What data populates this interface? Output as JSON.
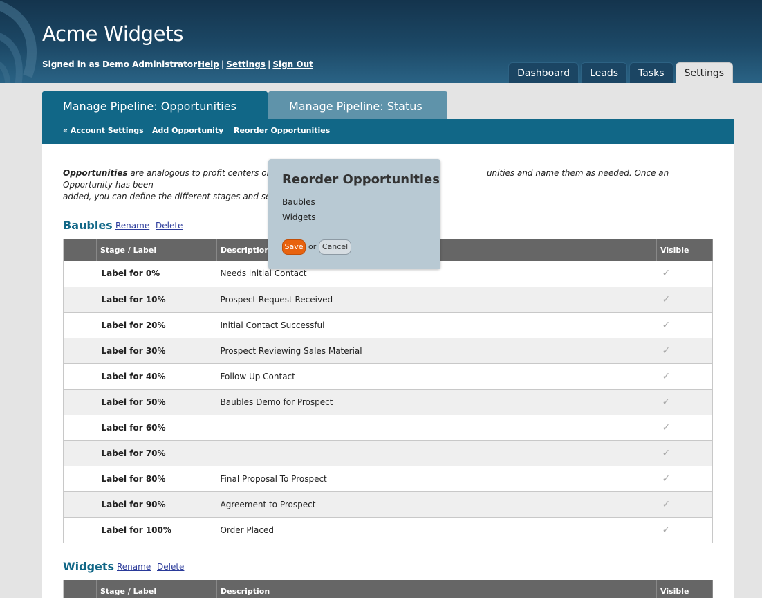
{
  "header": {
    "app_title": "Acme Widgets",
    "signed_in": "Signed in as Demo Administrator",
    "links": [
      "Help",
      "Settings",
      "Sign Out"
    ],
    "separator": "|"
  },
  "nav": {
    "tabs": [
      "Dashboard",
      "Leads",
      "Tasks",
      "Settings"
    ],
    "active": "Settings"
  },
  "subtabs": [
    "Manage Pipeline: Opportunities",
    "Manage Pipeline: Status"
  ],
  "subnav": [
    "« Account Settings",
    "Add Opportunity",
    "Reorder Opportunities"
  ],
  "intro": {
    "bold": "Opportunities",
    "line1": " are analogous to profit centers or p",
    "line1_end": "unities and name them as needed. Once an Opportunity has been",
    "line2": "added, you can define the different stages and set"
  },
  "table_headers": [
    "",
    "Stage / Label",
    "Description",
    "Visible"
  ],
  "groups": [
    {
      "name": "Baubles",
      "rename": "Rename",
      "delete": "Delete",
      "rows": [
        {
          "label": "Label for 0%",
          "desc": "Needs initial Contact"
        },
        {
          "label": "Label for 10%",
          "desc": "Prospect Request Received"
        },
        {
          "label": "Label for 20%",
          "desc": "Initial Contact Successful"
        },
        {
          "label": "Label for 30%",
          "desc": "Prospect Reviewing Sales Material"
        },
        {
          "label": "Label for 40%",
          "desc": "Follow Up Contact"
        },
        {
          "label": "Label for 50%",
          "desc": "Baubles Demo for Prospect"
        },
        {
          "label": "Label for 60%",
          "desc": ""
        },
        {
          "label": "Label for 70%",
          "desc": ""
        },
        {
          "label": "Label for 80%",
          "desc": "Final Proposal To Prospect"
        },
        {
          "label": "Label for 90%",
          "desc": "Agreement to Prospect"
        },
        {
          "label": "Label for 100%",
          "desc": "Order Placed"
        }
      ]
    },
    {
      "name": "Widgets",
      "rename": "Rename",
      "delete": "Delete",
      "rows": []
    }
  ],
  "checkmark": "✓",
  "popup": {
    "title": "Reorder Opportunities",
    "items": [
      "Baubles",
      "Widgets"
    ],
    "save": "Save",
    "or": "or",
    "cancel": "Cancel"
  }
}
